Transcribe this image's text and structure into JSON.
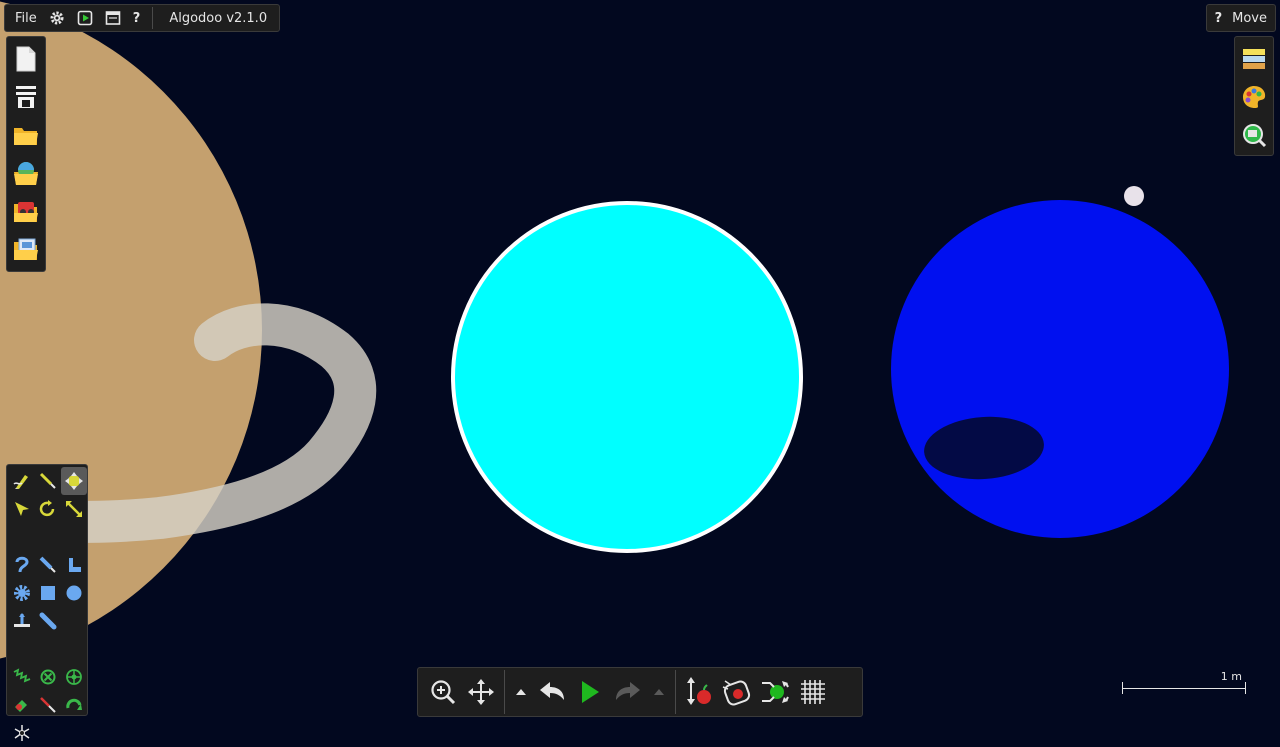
{
  "app": {
    "title": "Algodoo v2.1.0",
    "menu": {
      "file_label": "File",
      "help_label": "?"
    }
  },
  "mode": {
    "help_label": "?",
    "label": "Move"
  },
  "scale": {
    "label": "1 m"
  },
  "icons": {
    "top": [
      "gear-icon",
      "play-preview-icon",
      "window-icon",
      "help-icon"
    ],
    "left": [
      "new-scene-icon",
      "options-icon",
      "open-folder-icon",
      "browse-online-icon",
      "phunlets-icon",
      "save-scene-icon"
    ],
    "right": [
      "layers-icon",
      "appearance-palette-icon",
      "zoom-select-icon"
    ],
    "tools": [
      "sketch-tool-icon",
      "cut-tool-icon",
      "move-tool-icon",
      "drag-tool-icon",
      "rotate-tool-icon",
      "scale-tool-icon",
      "rope-tool-icon",
      "brush-tool-icon",
      "plane-tool-icon",
      "gear-tool-icon",
      "box-tool-icon",
      "circle-tool-icon",
      "fixate-tool-icon",
      "hinge-tool-icon",
      "spring-tool-icon",
      "axle-tool-icon",
      "thruster-tool-icon",
      "chain-tool-icon",
      "laser-tool-icon",
      "tracer-tool-icon",
      "spiral-tool-icon"
    ],
    "bottom": [
      "zoom-icon",
      "pan-icon",
      "arrow-up-small-icon",
      "undo-icon",
      "play-icon",
      "redo-icon",
      "arrow-up-small-icon",
      "gravity-icon",
      "air-friction-icon",
      "reset-icon",
      "grid-icon"
    ]
  },
  "colors": {
    "background": "#02081f",
    "planet_left": "#c4a06e",
    "ring": "#d6d1c6",
    "planet_cyan": "#00ffff",
    "planet_blue": "#0010f0",
    "blue_spot": "#030a45",
    "moon": "#e8e2ea",
    "play_green": "#1fb81f"
  }
}
